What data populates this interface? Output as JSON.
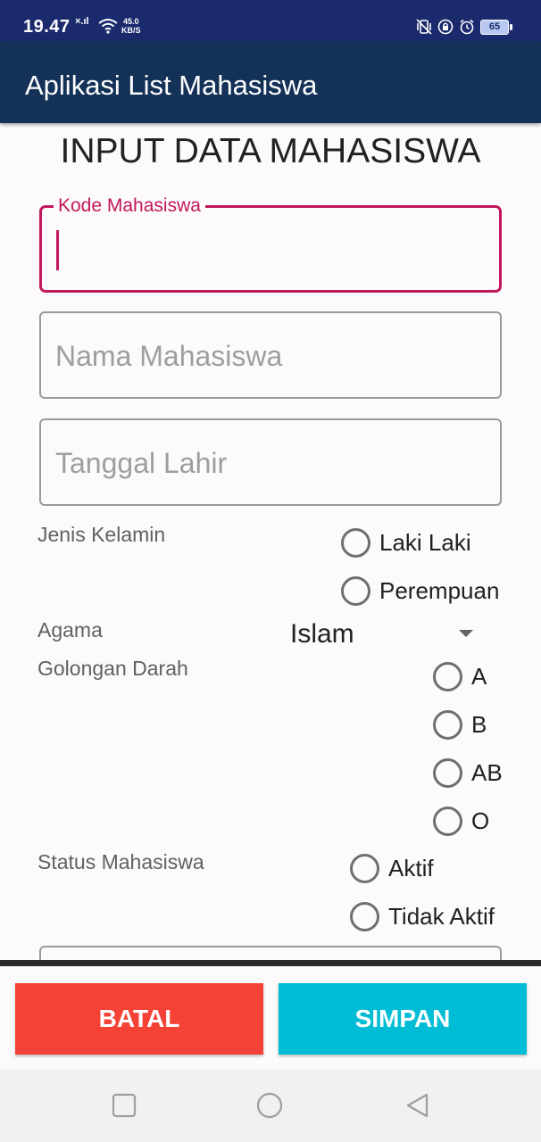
{
  "status_bar": {
    "time": "19.47",
    "signal": "×.ıl",
    "net_speed_value": "45.0",
    "net_speed_unit": "KB/S",
    "battery": "65"
  },
  "app_bar": {
    "title": "Aplikasi List Mahasiswa"
  },
  "form": {
    "title": "INPUT DATA MAHASISWA",
    "kode": {
      "label": "Kode Mahasiswa",
      "value": ""
    },
    "nama": {
      "placeholder": "Nama Mahasiswa"
    },
    "tanggal": {
      "placeholder": "Tanggal Lahir"
    },
    "jenis_kelamin": {
      "label": "Jenis Kelamin",
      "options": [
        "Laki Laki",
        "Perempuan"
      ]
    },
    "agama": {
      "label": "Agama",
      "selected": "Islam"
    },
    "golongan_darah": {
      "label": "Golongan Darah",
      "options": [
        "A",
        "B",
        "AB",
        "O"
      ]
    },
    "status": {
      "label": "Status Mahasiswa",
      "options": [
        "Aktif",
        "Tidak Aktif"
      ]
    }
  },
  "buttons": {
    "batal": "BATAL",
    "simpan": "SIMPAN"
  },
  "colors": {
    "status_bar": "#1a2a6c",
    "app_bar": "#143158",
    "accent": "#c2185b",
    "batal": "#f44336",
    "simpan": "#00bcd4"
  },
  "icons": {
    "nav_recent": "square-icon",
    "nav_home": "circle-icon",
    "nav_back": "triangle-back-icon"
  }
}
